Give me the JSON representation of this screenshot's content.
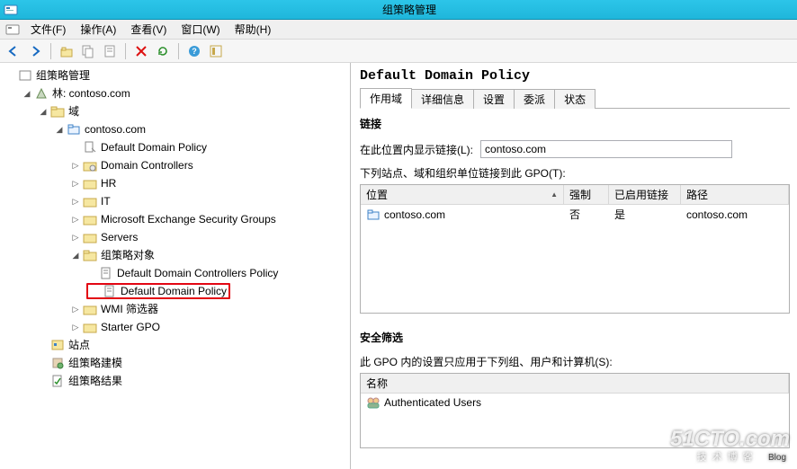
{
  "title": "组策略管理",
  "menu": {
    "file": "文件(F)",
    "action": "操作(A)",
    "view": "查看(V)",
    "window": "窗口(W)",
    "help": "帮助(H)"
  },
  "tree": {
    "root": "组策略管理",
    "forest": "林: contoso.com",
    "domains_label": "域",
    "domain": "contoso.com",
    "ddp": "Default Domain Policy",
    "dc": "Domain Controllers",
    "hr": "HR",
    "it": "IT",
    "mesg": "Microsoft Exchange Security Groups",
    "servers": "Servers",
    "gpo_container": "组策略对象",
    "ddcp": "Default Domain Controllers Policy",
    "ddp2": "Default Domain Policy",
    "wmi": "WMI 筛选器",
    "starter": "Starter GPO",
    "sites": "站点",
    "model": "组策略建模",
    "results": "组策略结果"
  },
  "detail": {
    "heading": "Default Domain Policy",
    "tabs": {
      "scope": "作用域",
      "details": "详细信息",
      "settings": "设置",
      "delegation": "委派",
      "status": "状态"
    },
    "links_title": "链接",
    "links_location_label": "在此位置内显示链接(L):",
    "links_location_value": "contoso.com",
    "links_list_label": "下列站点、域和组织单位链接到此 GPO(T):",
    "links_columns": {
      "location": "位置",
      "enforced": "强制",
      "enabled": "已启用链接",
      "path": "路径"
    },
    "links_row": {
      "location": "contoso.com",
      "enforced": "否",
      "enabled": "是",
      "path": "contoso.com"
    },
    "security_title": "安全筛选",
    "security_desc": "此 GPO 内的设置只应用于下列组、用户和计算机(S):",
    "security_columns": {
      "name": "名称"
    },
    "security_row": "Authenticated Users"
  },
  "watermark": {
    "main": "51CTO.com",
    "sub": "技术博客",
    "blog": "Blog"
  }
}
